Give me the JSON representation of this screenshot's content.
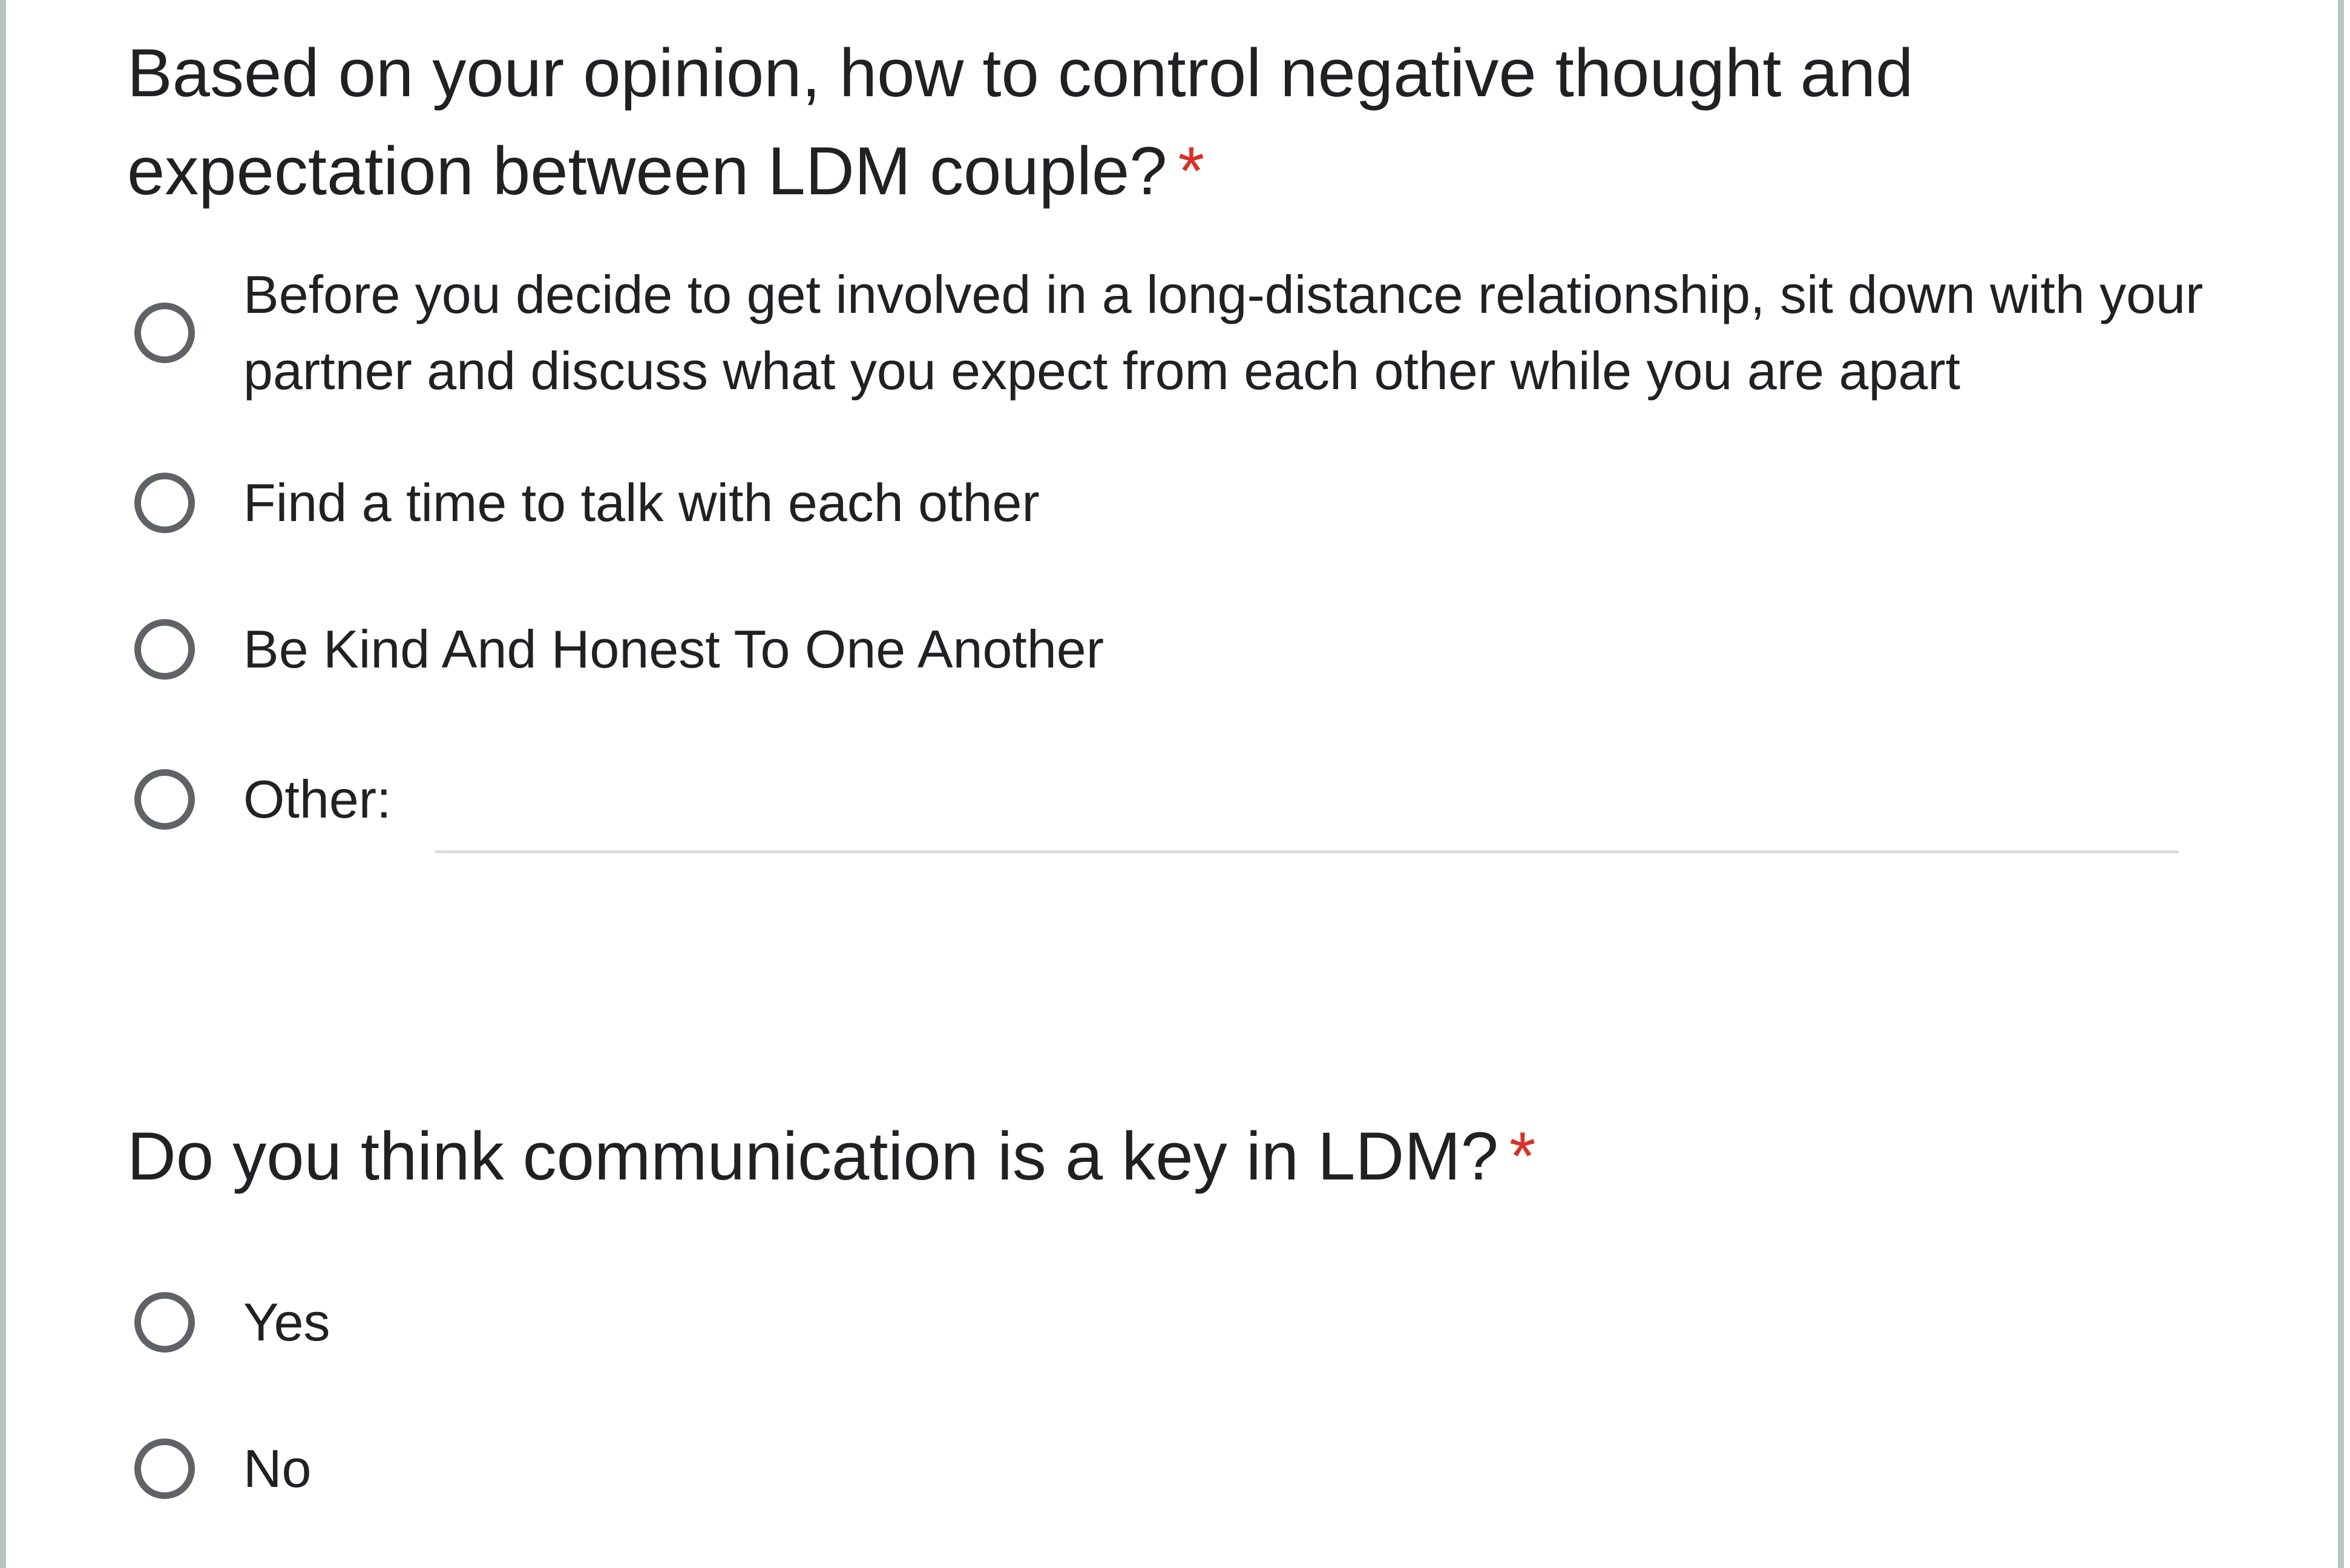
{
  "questions": [
    {
      "title": "Based on your opinion, how to control negative thought and expectation between LDM couple?",
      "required_mark": "*",
      "options": [
        "Before you decide to get involved in a long-distance relationship, sit down with your partner and discuss what you expect from each other while you are apart",
        "Find a time to talk with each other",
        "Be Kind And Honest To One Another"
      ],
      "other_label": "Other:",
      "other_value": ""
    },
    {
      "title": "Do you think communication is a key in LDM?",
      "required_mark": "*",
      "options": [
        "Yes",
        "No"
      ]
    }
  ],
  "colors": {
    "required": "#d93025",
    "text": "#202124",
    "radio_border": "#5f6368",
    "side_border": "#b9c4c2",
    "input_underline": "#dadce0"
  },
  "icons": {
    "radio": "radio-unchecked-icon"
  }
}
